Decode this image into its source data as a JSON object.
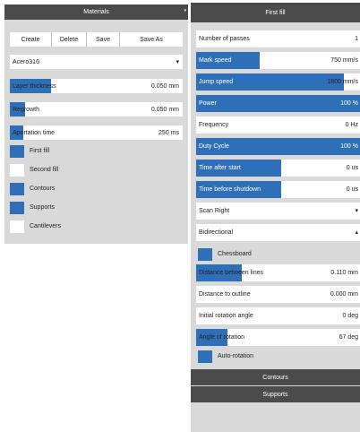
{
  "left": {
    "title": "Materials",
    "header_arrow": "▾",
    "buttons": [
      "Create",
      "Delete",
      "Save",
      "Save As"
    ],
    "material": {
      "value": "Acero316",
      "chevron": "▾"
    },
    "params": [
      {
        "label": "Layer thickness",
        "value": "0.050 mm",
        "level": 0.24
      },
      {
        "label": "Regrowth",
        "value": "0.050 mm",
        "level": 0.09
      },
      {
        "label": "Aportation time",
        "value": "250 ms",
        "level": 0.08
      }
    ],
    "checks": [
      {
        "label": "First fill",
        "checked": true
      },
      {
        "label": "Second fill",
        "checked": false
      },
      {
        "label": "Contours",
        "checked": true
      },
      {
        "label": "Supports",
        "checked": true
      },
      {
        "label": "Cantilevers",
        "checked": false
      }
    ]
  },
  "right": {
    "title": "First fill",
    "rows": [
      {
        "label": "Number of passes",
        "value": "1",
        "level": 0
      },
      {
        "label": "Mark speed",
        "value": "750 mm/s",
        "level": 0.39
      },
      {
        "label": "Jump speed",
        "value": "1800 mm/s",
        "level": 0.9
      },
      {
        "label": "Power",
        "value": "100 %",
        "level": 1.0
      },
      {
        "label": "Frequency",
        "value": "0 Hz",
        "level": 0
      },
      {
        "label": "Duty Cycle",
        "value": "100 %",
        "level": 1.0
      },
      {
        "label": "Time after start",
        "value": "0 us",
        "level": 0.52
      },
      {
        "label": "Time before shutdown",
        "value": "0 us",
        "level": 0.52
      }
    ],
    "dropdowns": [
      {
        "label": "Scan Right",
        "chevron": "▾"
      },
      {
        "label": "Bidirectional",
        "chevron": "▴"
      }
    ],
    "chessboard_label": "Chessboard",
    "rows2": [
      {
        "label": "Distance between lines",
        "value": "0.110 mm",
        "level": 0.28
      },
      {
        "label": "Distance to outline",
        "value": "0.000 mm",
        "level": 0
      },
      {
        "label": "Initial rotation angle",
        "value": "0 deg",
        "level": 0
      },
      {
        "label": "Angle of rotation",
        "value": "67 deg",
        "level": 0.19
      }
    ],
    "auto_rotation_label": "Auto-rotation",
    "sections": [
      "Contours",
      "Supports"
    ]
  }
}
